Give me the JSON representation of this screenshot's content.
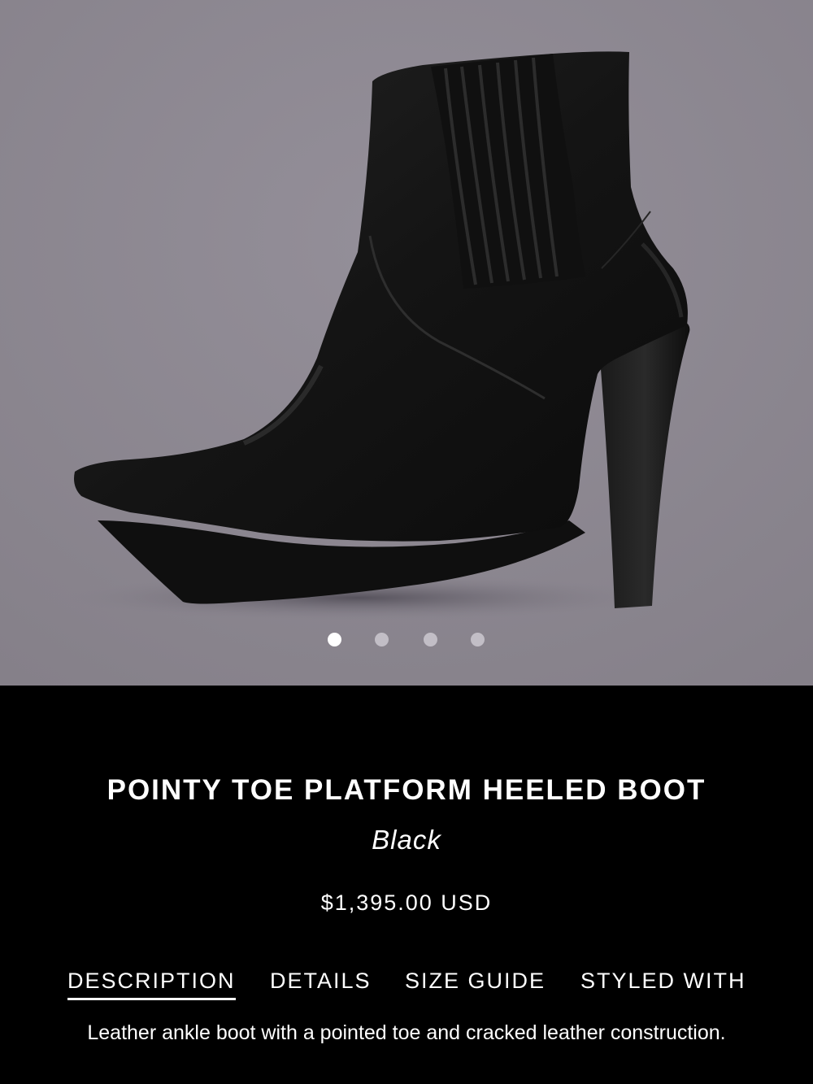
{
  "gallery": {
    "image_alt": "black leather pointy toe platform heeled ankle boot",
    "dots": [
      {
        "label": "slide 1",
        "active": true
      },
      {
        "label": "slide 2",
        "active": false
      },
      {
        "label": "slide 3",
        "active": false
      },
      {
        "label": "slide 4",
        "active": false
      }
    ]
  },
  "product": {
    "title": "POINTY TOE PLATFORM HEELED BOOT",
    "color": "Black",
    "price": "$1,395.00 USD",
    "description": "Leather ankle boot with a pointed toe and cracked leather construction."
  },
  "tabs": [
    {
      "label": "DESCRIPTION",
      "active": true
    },
    {
      "label": "DETAILS",
      "active": false
    },
    {
      "label": "SIZE GUIDE",
      "active": false
    },
    {
      "label": "STYLED WITH",
      "active": false
    }
  ],
  "colors": {
    "gallery_background": "#8c8791",
    "info_background": "#000000",
    "text": "#ffffff",
    "dot_inactive": "#c2bec6",
    "dot_active": "#ffffff"
  }
}
